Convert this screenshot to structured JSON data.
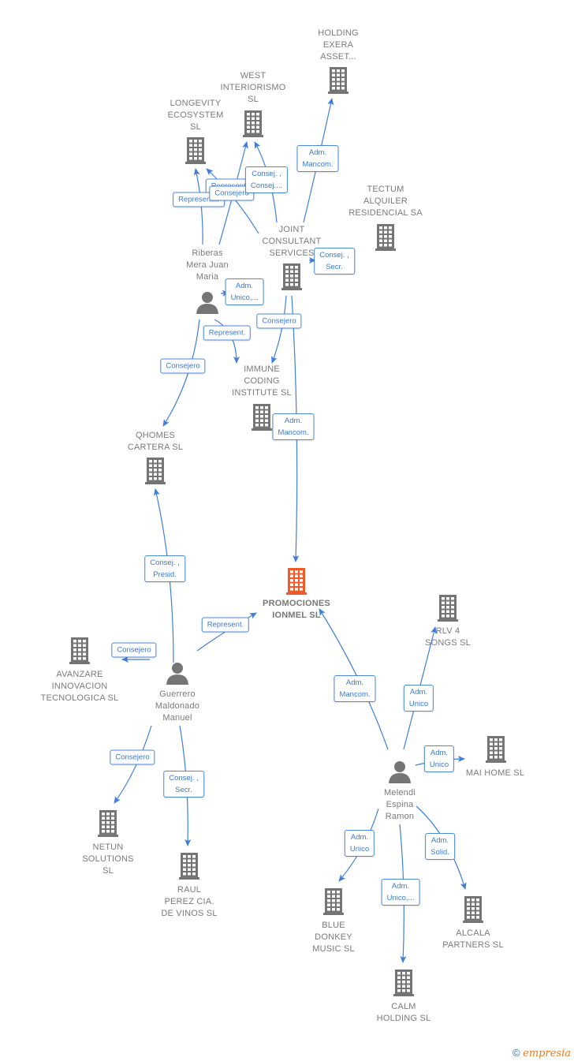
{
  "colors": {
    "edge": "#3f7fdc",
    "building": "#757575",
    "main_building": "#f05a28",
    "label_text": "#7a7a7a",
    "edge_label_text": "#3a7ad0"
  },
  "nodes": [
    {
      "id": "holding_exera",
      "label": "HOLDING\nEXERA\nASSET...",
      "type": "company"
    },
    {
      "id": "west",
      "label": "WEST\nINTERIORISMO\nSL",
      "type": "company"
    },
    {
      "id": "longevity",
      "label": "LONGEVITY\nECOSYSTEM\nSL",
      "type": "company"
    },
    {
      "id": "tectum",
      "label": "TECTUM\nALQUILER\nRESIDENCIAL SA",
      "type": "company"
    },
    {
      "id": "joint",
      "label": "JOINT\nCONSULTANT\nSERVICES",
      "type": "company"
    },
    {
      "id": "riberas",
      "label": "Riberas\nMera Juan\nMaria",
      "type": "person"
    },
    {
      "id": "immune",
      "label": "IMMUNE\nCODING\nINSTITUTE SL",
      "type": "company"
    },
    {
      "id": "qhomes",
      "label": "QHOMES\nCARTERA SL",
      "type": "company"
    },
    {
      "id": "promociones",
      "label": "PROMOCIONES\nIONMEL SL",
      "type": "main"
    },
    {
      "id": "rlv",
      "label": "RLV 4\nSONGS SL",
      "type": "company"
    },
    {
      "id": "avanzare",
      "label": "AVANZARE\nINNOVACION\nTECNOLOGICA SL",
      "type": "company"
    },
    {
      "id": "guerrero",
      "label": "Guerrero\nMaldonado\nManuel",
      "type": "person"
    },
    {
      "id": "maihome",
      "label": "MAI HOME SL",
      "type": "company"
    },
    {
      "id": "melendi",
      "label": "Melendi\nEspina\nRamon",
      "type": "person"
    },
    {
      "id": "netun",
      "label": "NETUN\nSOLUTIONS\nSL",
      "type": "company"
    },
    {
      "id": "raul",
      "label": "RAUL\nPEREZ CIA.\nDE VINOS SL",
      "type": "company"
    },
    {
      "id": "bluedonkey",
      "label": "BLUE\nDONKEY\nMUSIC SL",
      "type": "company"
    },
    {
      "id": "alcala",
      "label": "ALCALA\nPARTNERS SL",
      "type": "company"
    },
    {
      "id": "calm",
      "label": "CALM\nHOLDING SL",
      "type": "company"
    }
  ],
  "edges": [
    {
      "from": "joint",
      "to": "holding_exera",
      "label": "Adm.\nMancom."
    },
    {
      "from": "riberas",
      "to": "west",
      "label": "Represent."
    },
    {
      "from": "riberas",
      "to": "longevity",
      "label": "Represent..."
    },
    {
      "from": "joint",
      "to": "longevity",
      "label": "Consejero"
    },
    {
      "from": "joint",
      "to": "west",
      "label": "Consej. ,\nConsej...."
    },
    {
      "from": "joint",
      "to": "tectum",
      "label": "Consej. ,\nSecr."
    },
    {
      "from": "riberas",
      "to": "joint",
      "label": "Adm.\nUnico,..."
    },
    {
      "from": "riberas",
      "to": "immune",
      "label": "Represent."
    },
    {
      "from": "joint",
      "to": "immune",
      "label": "Consejero"
    },
    {
      "from": "riberas",
      "to": "qhomes",
      "label": "Consejero"
    },
    {
      "from": "joint",
      "to": "promociones",
      "label": "Adm.\nMancom."
    },
    {
      "from": "guerrero",
      "to": "qhomes",
      "label": "Consej. ,\nPresid."
    },
    {
      "from": "guerrero",
      "to": "promociones",
      "label": "Represent."
    },
    {
      "from": "guerrero",
      "to": "avanzare",
      "label": "Consejero"
    },
    {
      "from": "guerrero",
      "to": "netun",
      "label": "Consejero"
    },
    {
      "from": "guerrero",
      "to": "raul",
      "label": "Consej. ,\nSecr."
    },
    {
      "from": "melendi",
      "to": "promociones",
      "label": "Adm.\nMancom."
    },
    {
      "from": "melendi",
      "to": "rlv",
      "label": "Adm.\nUnico"
    },
    {
      "from": "melendi",
      "to": "maihome",
      "label": "Adm.\nUnico"
    },
    {
      "from": "melendi",
      "to": "bluedonkey",
      "label": "Adm.\nUnico"
    },
    {
      "from": "melendi",
      "to": "calm",
      "label": "Adm.\nUnico,..."
    },
    {
      "from": "melendi",
      "to": "alcala",
      "label": "Adm.\nSolid."
    }
  ],
  "footer": {
    "copyright": "©",
    "brand": "empresia"
  }
}
